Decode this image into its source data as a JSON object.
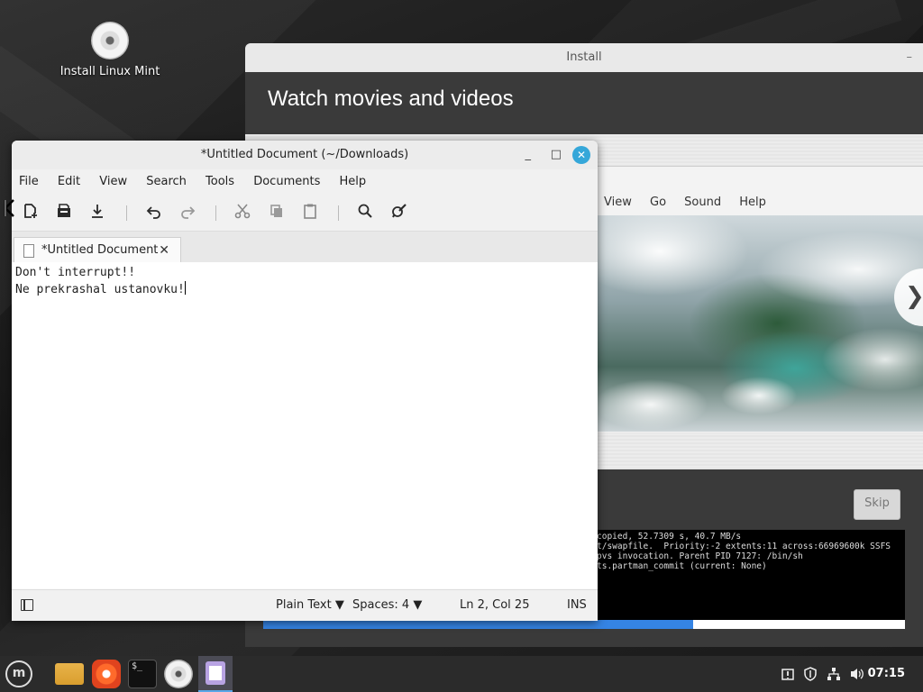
{
  "desktop": {
    "icon_label": "Install Linux Mint"
  },
  "installer": {
    "title": "Install",
    "minimize": "–",
    "heading": "Watch movies and videos",
    "media_menu": [
      "View",
      "Go",
      "Sound",
      "Help"
    ],
    "next_arrow": "❯",
    "skip_label": "Skip",
    "console_lines": [
      "copied, 52.7309 s, 40.7 MB/s",
      "t/swapfile.  Priority:-2 extents:11 across:66969600k SSFS",
      "pvs invocation. Parent PID 7127: /bin/sh",
      "",
      "ts.partman_commit (current: None)"
    ],
    "progress": 0.67
  },
  "editor": {
    "title": "*Untitled Document (~/Downloads)",
    "min": "_",
    "max": "□",
    "close": "✕",
    "menu": [
      "File",
      "Edit",
      "View",
      "Search",
      "Tools",
      "Documents",
      "Help"
    ],
    "tab_label": "*Untitled Document",
    "tab_close": "✕",
    "lines": [
      "Don't interrupt!!",
      "Ne prekrashal ustanovku!"
    ],
    "status": {
      "language": "Plain Text",
      "spaces": "Spaces: 4",
      "position": "Ln 2, Col 25",
      "mode": "INS"
    }
  },
  "taskbar": {
    "terminal_glyph": "$_",
    "clock": "07:15",
    "tray_icons": [
      "update-icon",
      "shield-icon",
      "network-icon",
      "volume-icon"
    ]
  }
}
